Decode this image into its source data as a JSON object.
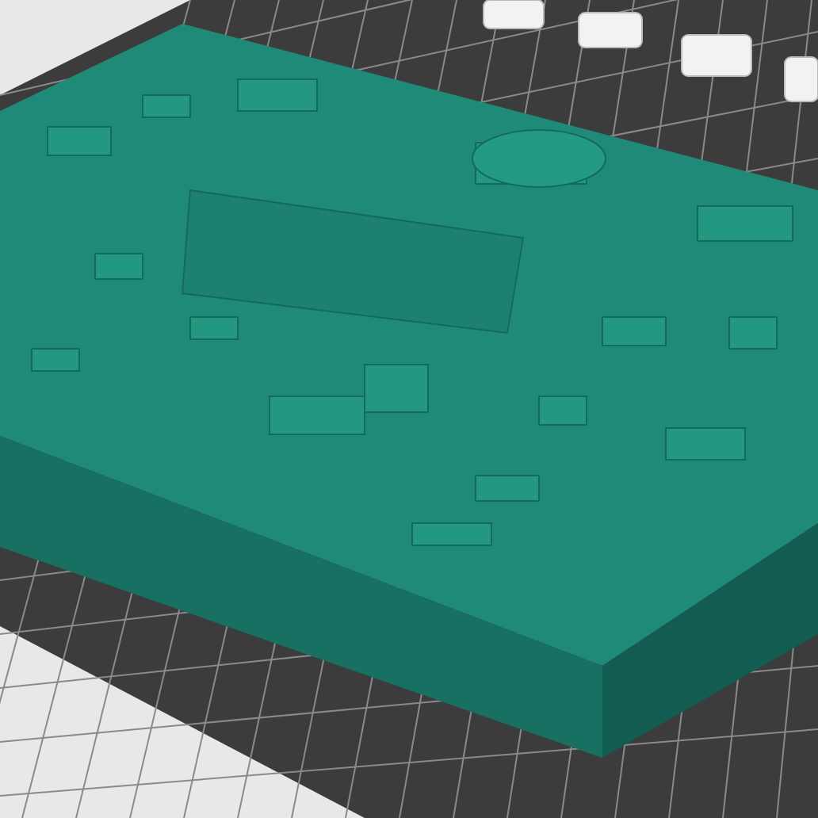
{
  "viewport": {
    "model": {
      "selected": false
    }
  }
}
